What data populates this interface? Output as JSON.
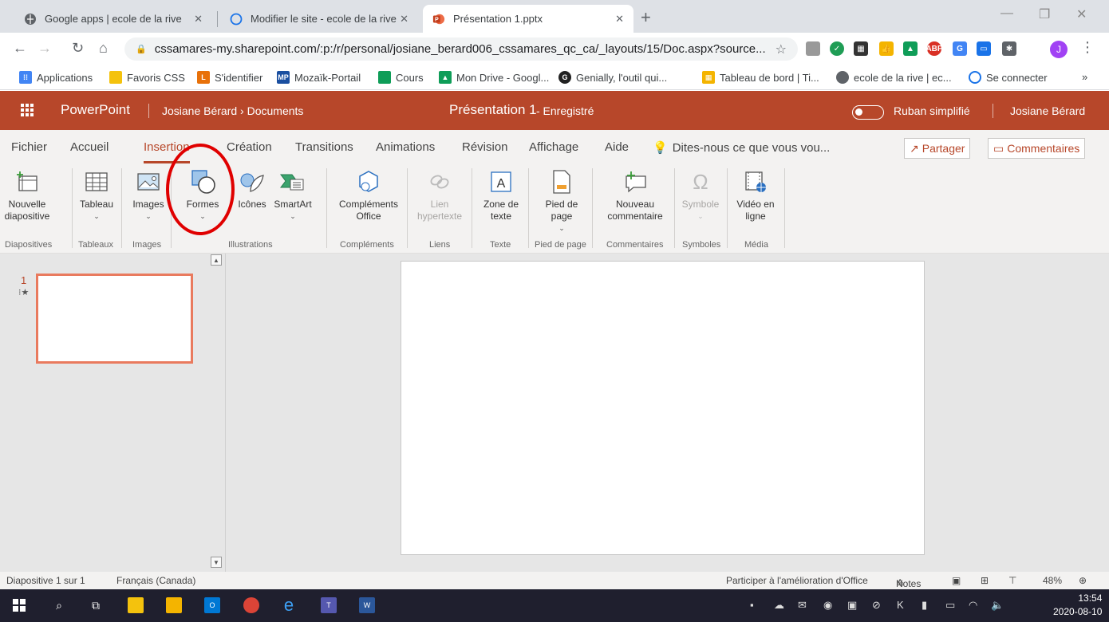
{
  "browser": {
    "tabs": [
      {
        "title": "Google apps | ecole de la rive",
        "active": false
      },
      {
        "title": "Modifier le site - ecole de la rive",
        "active": false
      },
      {
        "title": "Présentation 1.pptx",
        "active": true
      }
    ],
    "url": "cssamares-my.sharepoint.com/:p:/r/personal/josiane_berard006_cssamares_qc_ca/_layouts/15/Doc.aspx?source...",
    "profile_initial": "J",
    "bookmarks": [
      {
        "label": "Applications",
        "icon": "apps-grid-icon",
        "color": "#4285f4"
      },
      {
        "label": "Favoris CSS",
        "icon": "folder-icon",
        "color": "#f4c20d"
      },
      {
        "label": "S'identifier",
        "icon": "login-icon",
        "color": "#e8710a"
      },
      {
        "label": "Mozaïk-Portail",
        "icon": "mp-icon",
        "color": "#1a4fa0"
      },
      {
        "label": "Cours",
        "icon": "classroom-icon",
        "color": "#f4b400"
      },
      {
        "label": "Mon Drive - Googl...",
        "icon": "drive-icon",
        "color": "#0f9d58"
      },
      {
        "label": "Genially, l'outil qui...",
        "icon": "genially-icon",
        "color": "#222"
      },
      {
        "label": "Tableau de bord | Ti...",
        "icon": "dashboard-icon",
        "color": "#f4b400"
      },
      {
        "label": "ecole de la rive | ec...",
        "icon": "globe-icon",
        "color": "#555"
      },
      {
        "label": "Se connecter",
        "icon": "sites-icon",
        "color": "#1a73e8"
      }
    ]
  },
  "app": {
    "name": "PowerPoint",
    "breadcrumb": "Josiane Bérard › Documents",
    "doc_title": "Présentation 1",
    "doc_status": "-  Enregistré",
    "simplified_ribbon_label": "Ruban simplifié",
    "user_name": "Josiane Bérard",
    "accent": "#b7472a"
  },
  "ribbon": {
    "tabs": [
      "Fichier",
      "Accueil",
      "Insertion",
      "Création",
      "Transitions",
      "Animations",
      "Révision",
      "Affichage",
      "Aide"
    ],
    "active_tab": "Insertion",
    "tell_me": "Dites-nous ce que vous vou...",
    "share": "Partager",
    "comments": "Commentaires",
    "buttons": {
      "new_slide": "Nouvelle diapositive",
      "table": "Tableau",
      "images": "Images",
      "shapes": "Formes",
      "icons": "Icônes",
      "smartart": "SmartArt",
      "addins": "Compléments Office",
      "link": "Lien hypertexte",
      "textbox": "Zone de texte",
      "footer": "Pied de page",
      "new_comment": "Nouveau commentaire",
      "symbol": "Symbole",
      "video": "Vidéo en ligne"
    },
    "groups": {
      "slides": "Diapositives",
      "tables": "Tableaux",
      "images": "Images",
      "illustrations": "Illustrations",
      "addins": "Compléments",
      "links": "Liens",
      "text": "Texte",
      "footer": "Pied de page",
      "comments": "Commentaires",
      "symbols": "Symboles",
      "media": "Média"
    }
  },
  "thumbnails": {
    "slide_number": "1"
  },
  "status": {
    "slide_count": "Diapositive 1 sur 1",
    "language": "Français (Canada)",
    "feedback": "Participer à l'amélioration d'Office",
    "notes": "Notes",
    "zoom": "48%"
  },
  "taskbar": {
    "time": "13:54",
    "date": "2020-08-10"
  }
}
